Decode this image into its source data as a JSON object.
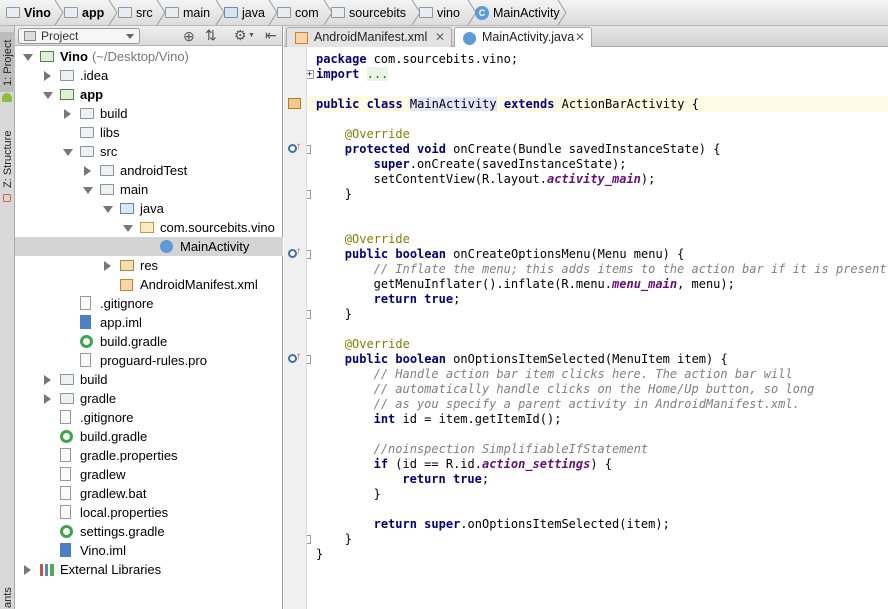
{
  "breadcrumb": [
    {
      "label": "Vino",
      "icon": "project-folder-icon"
    },
    {
      "label": "app",
      "icon": "module-folder-icon"
    },
    {
      "label": "src",
      "icon": "folder-icon"
    },
    {
      "label": "main",
      "icon": "folder-icon"
    },
    {
      "label": "java",
      "icon": "source-folder-icon"
    },
    {
      "label": "com",
      "icon": "folder-icon"
    },
    {
      "label": "sourcebits",
      "icon": "folder-icon"
    },
    {
      "label": "vino",
      "icon": "folder-icon"
    },
    {
      "label": "MainActivity",
      "icon": "class-icon"
    }
  ],
  "side_tabs": {
    "project": "1: Project",
    "structure": "Z: Structure",
    "variants": "ants"
  },
  "project_panel": {
    "view_select": "Project",
    "tree": [
      {
        "label": "Vino",
        "extra": "(~/Desktop/Vino)",
        "bold": true,
        "icon": "module-icon",
        "arrow": "down",
        "depth": 0
      },
      {
        "label": ".idea",
        "icon": "folder-icon",
        "arrow": "right",
        "depth": 1
      },
      {
        "label": "app",
        "bold": true,
        "icon": "module-icon",
        "arrow": "down",
        "depth": 1
      },
      {
        "label": "build",
        "icon": "folder-icon",
        "arrow": "right",
        "depth": 2
      },
      {
        "label": "libs",
        "icon": "folder-icon",
        "arrow": "",
        "depth": 2
      },
      {
        "label": "src",
        "icon": "folder-icon",
        "arrow": "down",
        "depth": 2
      },
      {
        "label": "androidTest",
        "icon": "folder-icon",
        "arrow": "right",
        "depth": 3
      },
      {
        "label": "main",
        "icon": "folder-icon",
        "arrow": "down",
        "depth": 3
      },
      {
        "label": "java",
        "icon": "source-folder-icon",
        "arrow": "down",
        "depth": 4
      },
      {
        "label": "com.sourcebits.vino",
        "icon": "package-icon",
        "arrow": "down",
        "depth": 5
      },
      {
        "label": "MainActivity",
        "icon": "class-icon",
        "arrow": "",
        "depth": 6,
        "selected": true
      },
      {
        "label": "res",
        "icon": "resource-folder-icon",
        "arrow": "right",
        "depth": 4
      },
      {
        "label": "AndroidManifest.xml",
        "icon": "xml-file-icon",
        "arrow": "",
        "depth": 4
      },
      {
        "label": ".gitignore",
        "icon": "text-file-icon",
        "arrow": "",
        "depth": 2
      },
      {
        "label": "app.iml",
        "icon": "iml-file-icon",
        "arrow": "",
        "depth": 2
      },
      {
        "label": "build.gradle",
        "icon": "gradle-icon",
        "arrow": "",
        "depth": 2
      },
      {
        "label": "proguard-rules.pro",
        "icon": "text-file-icon",
        "arrow": "",
        "depth": 2
      },
      {
        "label": "build",
        "icon": "folder-icon",
        "arrow": "right",
        "depth": 1
      },
      {
        "label": "gradle",
        "icon": "folder-icon",
        "arrow": "right",
        "depth": 1
      },
      {
        "label": ".gitignore",
        "icon": "text-file-icon",
        "arrow": "",
        "depth": 1
      },
      {
        "label": "build.gradle",
        "icon": "gradle-icon",
        "arrow": "",
        "depth": 1
      },
      {
        "label": "gradle.properties",
        "icon": "text-file-icon",
        "arrow": "",
        "depth": 1
      },
      {
        "label": "gradlew",
        "icon": "text-file-icon",
        "arrow": "",
        "depth": 1
      },
      {
        "label": "gradlew.bat",
        "icon": "text-file-icon",
        "arrow": "",
        "depth": 1
      },
      {
        "label": "local.properties",
        "icon": "text-file-icon",
        "arrow": "",
        "depth": 1
      },
      {
        "label": "settings.gradle",
        "icon": "gradle-icon",
        "arrow": "",
        "depth": 1
      },
      {
        "label": "Vino.iml",
        "icon": "iml-file-icon",
        "arrow": "",
        "depth": 1
      },
      {
        "label": "External Libraries",
        "icon": "library-icon",
        "arrow": "right",
        "depth": 0
      }
    ]
  },
  "editor": {
    "tabs": [
      {
        "label": "AndroidManifest.xml",
        "icon": "xml-file-icon",
        "active": false
      },
      {
        "label": "MainActivity.java",
        "icon": "class-icon",
        "active": true
      }
    ],
    "code_lines": [
      {
        "y": 0,
        "segs": [
          [
            "kw",
            "package"
          ],
          [
            "",
            "com.sourcebits.vino;"
          ]
        ],
        "ind": 0,
        "sp": [
          " ",
          ""
        ]
      },
      {
        "y": 1,
        "segs": [
          [
            "kw",
            "import"
          ],
          [
            "",
            " "
          ],
          [
            "imp",
            "..."
          ]
        ],
        "ind": 0
      },
      {
        "y": 2,
        "segs": [],
        "ind": 0
      },
      {
        "y": 3,
        "segs": [
          [
            "kw",
            "public class "
          ],
          [
            "idh",
            "MainActivity"
          ],
          [
            "kw",
            " extends "
          ],
          [
            "",
            "ActionBarActivity {"
          ]
        ],
        "ind": 0,
        "highlight": true
      },
      {
        "y": 4,
        "segs": [],
        "ind": 0
      },
      {
        "y": 5,
        "segs": [
          [
            "an",
            "@Override"
          ]
        ],
        "ind": 4
      },
      {
        "y": 6,
        "segs": [
          [
            "kw",
            "protected void "
          ],
          [
            "",
            "onCreate(Bundle savedInstanceState) {"
          ]
        ],
        "ind": 4
      },
      {
        "y": 7,
        "segs": [
          [
            "kw",
            "super"
          ],
          [
            "",
            ".onCreate(savedInstanceState);"
          ]
        ],
        "ind": 8
      },
      {
        "y": 8,
        "segs": [
          [
            "",
            "setContentView(R.layout."
          ],
          [
            "fi",
            "activity_main"
          ],
          [
            "",
            ");"
          ]
        ],
        "ind": 8
      },
      {
        "y": 9,
        "segs": [
          [
            "",
            "}"
          ]
        ],
        "ind": 4
      },
      {
        "y": 10,
        "segs": [],
        "ind": 0
      },
      {
        "y": 11,
        "segs": [],
        "ind": 0
      },
      {
        "y": 12,
        "segs": [
          [
            "an",
            "@Override"
          ]
        ],
        "ind": 4
      },
      {
        "y": 13,
        "segs": [
          [
            "kw",
            "public boolean "
          ],
          [
            "",
            "onCreateOptionsMenu(Menu menu) {"
          ]
        ],
        "ind": 4
      },
      {
        "y": 14,
        "segs": [
          [
            "cm",
            "// Inflate the menu; this adds items to the action bar if it is present."
          ]
        ],
        "ind": 8
      },
      {
        "y": 15,
        "segs": [
          [
            "",
            "getMenuInflater().inflate(R.menu."
          ],
          [
            "fi",
            "menu_main"
          ],
          [
            "",
            ", menu);"
          ]
        ],
        "ind": 8
      },
      {
        "y": 16,
        "segs": [
          [
            "kw",
            "return true"
          ],
          [
            "",
            ";"
          ]
        ],
        "ind": 8
      },
      {
        "y": 17,
        "segs": [
          [
            "",
            "}"
          ]
        ],
        "ind": 4
      },
      {
        "y": 18,
        "segs": [],
        "ind": 0
      },
      {
        "y": 19,
        "segs": [
          [
            "an",
            "@Override"
          ]
        ],
        "ind": 4
      },
      {
        "y": 20,
        "segs": [
          [
            "kw",
            "public boolean "
          ],
          [
            "",
            "onOptionsItemSelected(MenuItem item) {"
          ]
        ],
        "ind": 4
      },
      {
        "y": 21,
        "segs": [
          [
            "cm",
            "// Handle action bar item clicks here. The action bar will"
          ]
        ],
        "ind": 8
      },
      {
        "y": 22,
        "segs": [
          [
            "cm",
            "// automatically handle clicks on the Home/Up button, so long"
          ]
        ],
        "ind": 8
      },
      {
        "y": 23,
        "segs": [
          [
            "cm",
            "// as you specify a parent activity in AndroidManifest.xml."
          ]
        ],
        "ind": 8
      },
      {
        "y": 24,
        "segs": [
          [
            "kw",
            "int "
          ],
          [
            "",
            "id = item.getItemId();"
          ]
        ],
        "ind": 8
      },
      {
        "y": 25,
        "segs": [],
        "ind": 0
      },
      {
        "y": 26,
        "segs": [
          [
            "cm",
            "//noinspection SimplifiableIfStatement"
          ]
        ],
        "ind": 8
      },
      {
        "y": 27,
        "segs": [
          [
            "kw",
            "if "
          ],
          [
            "",
            "(id == R.id."
          ],
          [
            "fi",
            "action_settings"
          ],
          [
            "",
            ") {"
          ]
        ],
        "ind": 8
      },
      {
        "y": 28,
        "segs": [
          [
            "kw",
            "return true"
          ],
          [
            "",
            ";"
          ]
        ],
        "ind": 12
      },
      {
        "y": 29,
        "segs": [
          [
            "",
            "}"
          ]
        ],
        "ind": 8
      },
      {
        "y": 30,
        "segs": [],
        "ind": 0
      },
      {
        "y": 31,
        "segs": [
          [
            "kw",
            "return super"
          ],
          [
            "",
            ".onOptionsItemSelected(item);"
          ]
        ],
        "ind": 8
      },
      {
        "y": 32,
        "segs": [
          [
            "",
            "}"
          ]
        ],
        "ind": 4
      },
      {
        "y": 33,
        "segs": [
          [
            "",
            "}"
          ]
        ],
        "ind": 0
      }
    ]
  }
}
